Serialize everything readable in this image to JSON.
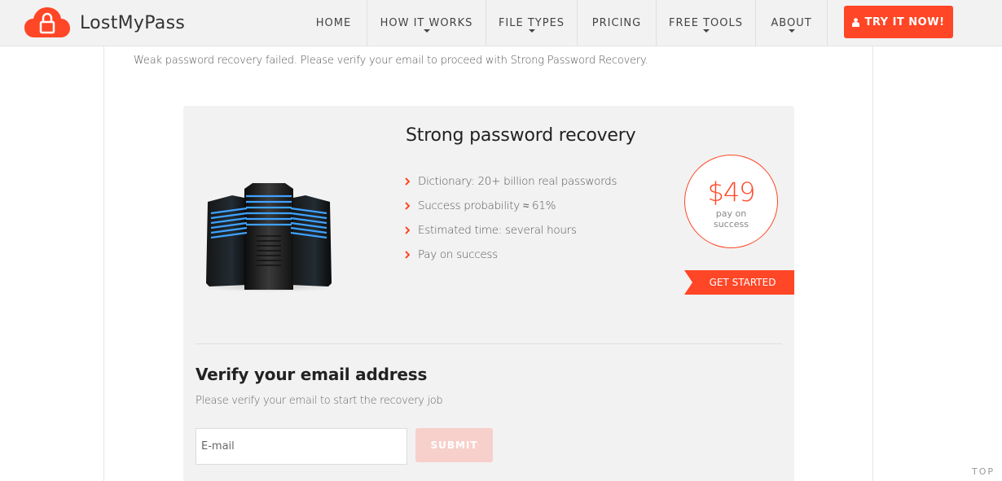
{
  "header": {
    "brand": "LostMyPass",
    "logo_icon": "cloud-lock-icon",
    "nav": [
      {
        "label": "HOME",
        "has_dropdown": false
      },
      {
        "label": "HOW IT WORKS",
        "has_dropdown": true
      },
      {
        "label": "FILE TYPES",
        "has_dropdown": true
      },
      {
        "label": "PRICING",
        "has_dropdown": false
      },
      {
        "label": "FREE TOOLS",
        "has_dropdown": true
      },
      {
        "label": "ABOUT",
        "has_dropdown": true
      }
    ],
    "cta": {
      "label": "TRY IT NOW!",
      "icon": "user-icon"
    }
  },
  "notice": "Weak password recovery failed. Please verify your email to proceed with Strong Password Recovery.",
  "offer": {
    "image": "server-racks-image",
    "title": "Strong password recovery",
    "features": [
      "Dictionary: 20+ billion real passwords",
      "Success probability ≈ 61%",
      "Estimated time: several hours",
      "Pay on success"
    ],
    "price": "$49",
    "price_note": "pay on success",
    "price_note_lines": [
      "pay on",
      "success"
    ],
    "cta_label": "GET STARTED"
  },
  "verify": {
    "title": "Verify your email address",
    "subtitle": "Please verify your email to start the recovery job",
    "email_value": "",
    "email_placeholder": "E-mail",
    "submit_label": "SUBMIT"
  },
  "scroll_top_label": "TOP",
  "colors": {
    "accent": "#ff4626",
    "header_bg": "#f2f2f2",
    "card_bg": "#f2f2f2",
    "submit_disabled": "#f7d0cb"
  }
}
